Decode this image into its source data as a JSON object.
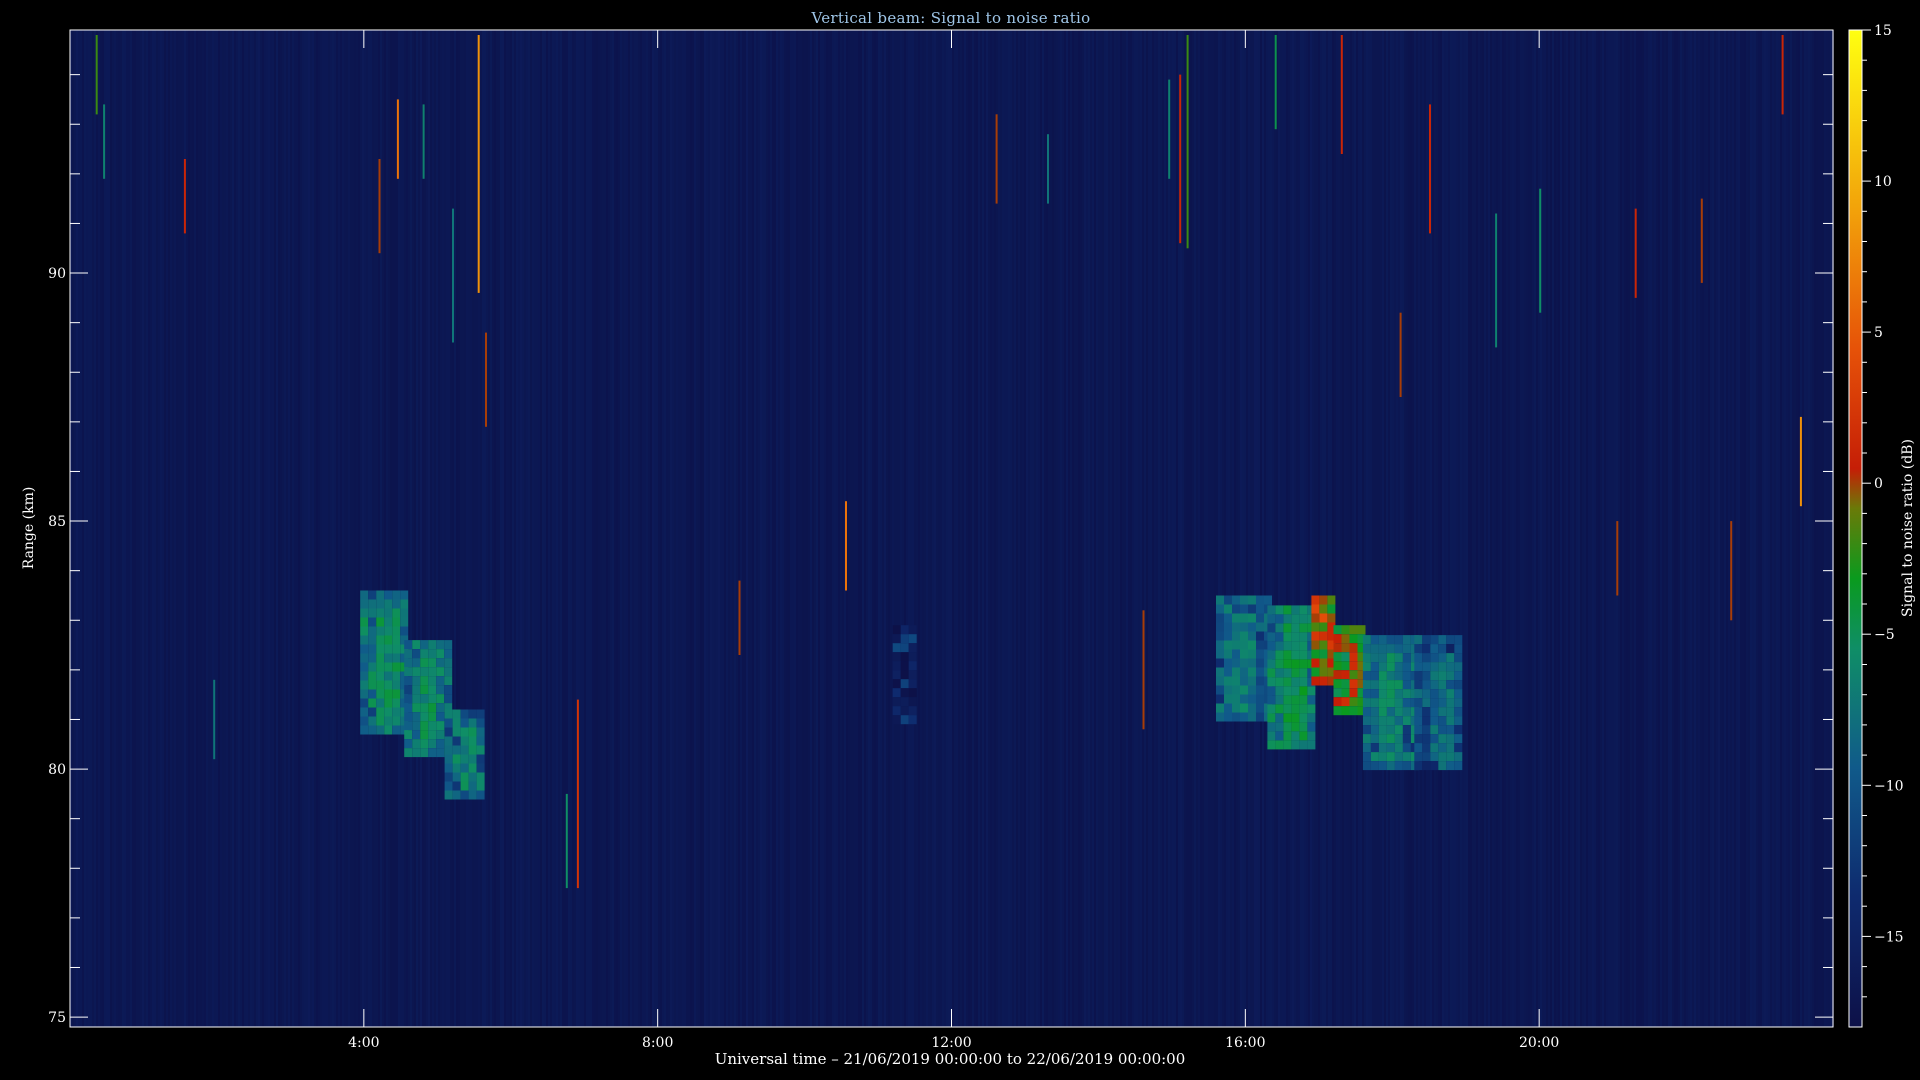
{
  "chart_data": {
    "type": "heatmap",
    "title": "Vertical beam: Signal to noise ratio",
    "xlabel": "Universal time – 21/06/2019 00:00:00 to 22/06/2019 00:00:00",
    "ylabel": "Range (km)",
    "colorbar_label": "Signal to noise ratio (dB)",
    "x_range_hours": [
      0,
      24
    ],
    "y_range_km": [
      74.8,
      94.9
    ],
    "color_range_db": [
      -18,
      15
    ],
    "x_ticks": [
      {
        "hours": 4,
        "label": "4:00"
      },
      {
        "hours": 8,
        "label": "8:00"
      },
      {
        "hours": 12,
        "label": "12:00"
      },
      {
        "hours": 16,
        "label": "16:00"
      },
      {
        "hours": 20,
        "label": "20:00"
      }
    ],
    "y_ticks": [
      {
        "km": 75,
        "label": "75"
      },
      {
        "km": 80,
        "label": "80"
      },
      {
        "km": 85,
        "label": "85"
      },
      {
        "km": 90,
        "label": "90"
      }
    ],
    "colorbar_ticks": [
      {
        "db": 15,
        "label": "15"
      },
      {
        "db": 10,
        "label": "10"
      },
      {
        "db": 5,
        "label": "5"
      },
      {
        "db": 0,
        "label": "0"
      },
      {
        "db": -5,
        "label": "−5"
      },
      {
        "db": -10,
        "label": "−10"
      },
      {
        "db": -15,
        "label": "−15"
      }
    ],
    "background_db": -17,
    "echo_regions": [
      {
        "t0": 3.95,
        "t1": 4.55,
        "r0": 80.8,
        "r1": 83.6,
        "snr_db": -6
      },
      {
        "t0": 4.55,
        "t1": 5.1,
        "r0": 80.3,
        "r1": 82.6,
        "snr_db": -6
      },
      {
        "t0": 5.1,
        "t1": 5.6,
        "r0": 79.5,
        "r1": 81.2,
        "snr_db": -7
      },
      {
        "t0": 11.2,
        "t1": 11.5,
        "r0": 81.0,
        "r1": 82.9,
        "snr_db": -13
      },
      {
        "t0": 15.6,
        "t1": 16.3,
        "r0": 81.0,
        "r1": 83.5,
        "snr_db": -8
      },
      {
        "t0": 16.3,
        "t1": 16.9,
        "r0": 80.5,
        "r1": 83.3,
        "snr_db": -5
      },
      {
        "t0": 16.9,
        "t1": 17.2,
        "r0": 81.7,
        "r1": 83.5,
        "snr_db": 2
      },
      {
        "t0": 17.2,
        "t1": 17.6,
        "r0": 81.1,
        "r1": 82.9,
        "snr_db": 0
      },
      {
        "t0": 17.6,
        "t1": 18.3,
        "r0": 80.0,
        "r1": 82.7,
        "snr_db": -7
      },
      {
        "t0": 18.3,
        "t1": 18.9,
        "r0": 80.0,
        "r1": 82.7,
        "snr_db": -9
      }
    ],
    "spikes": [
      {
        "t": 0.35,
        "r0": 93.2,
        "r1": 94.8,
        "snr_db": -2
      },
      {
        "t": 0.45,
        "r0": 91.9,
        "r1": 93.4,
        "snr_db": -7
      },
      {
        "t": 1.55,
        "r0": 90.8,
        "r1": 92.3,
        "snr_db": 1
      },
      {
        "t": 1.95,
        "r0": 80.2,
        "r1": 81.8,
        "snr_db": -8
      },
      {
        "t": 4.2,
        "r0": 90.4,
        "r1": 92.3,
        "snr_db": 0
      },
      {
        "t": 4.45,
        "r0": 91.9,
        "r1": 93.5,
        "snr_db": 6
      },
      {
        "t": 4.8,
        "r0": 91.9,
        "r1": 93.4,
        "snr_db": -7
      },
      {
        "t": 5.2,
        "r0": 88.6,
        "r1": 91.3,
        "snr_db": -8
      },
      {
        "t": 5.55,
        "r0": 89.6,
        "r1": 94.8,
        "snr_db": 8
      },
      {
        "t": 5.65,
        "r0": 86.9,
        "r1": 88.8,
        "snr_db": 0
      },
      {
        "t": 6.9,
        "r0": 77.6,
        "r1": 81.4,
        "snr_db": 2
      },
      {
        "t": 6.75,
        "r0": 77.6,
        "r1": 79.5,
        "snr_db": -6
      },
      {
        "t": 9.1,
        "r0": 82.3,
        "r1": 83.8,
        "snr_db": 0
      },
      {
        "t": 10.55,
        "r0": 83.6,
        "r1": 85.4,
        "snr_db": 6
      },
      {
        "t": 12.6,
        "r0": 91.4,
        "r1": 93.2,
        "snr_db": 0
      },
      {
        "t": 13.3,
        "r0": 91.4,
        "r1": 92.8,
        "snr_db": -8
      },
      {
        "t": 14.6,
        "r0": 80.8,
        "r1": 83.2,
        "snr_db": 0
      },
      {
        "t": 14.95,
        "r0": 91.9,
        "r1": 93.9,
        "snr_db": -7
      },
      {
        "t": 15.1,
        "r0": 90.6,
        "r1": 94.0,
        "snr_db": 1
      },
      {
        "t": 15.2,
        "r0": 90.5,
        "r1": 94.8,
        "snr_db": -2
      },
      {
        "t": 16.4,
        "r0": 92.9,
        "r1": 94.8,
        "snr_db": -5
      },
      {
        "t": 17.3,
        "r0": 92.4,
        "r1": 94.8,
        "snr_db": 1
      },
      {
        "t": 18.1,
        "r0": 87.5,
        "r1": 89.2,
        "snr_db": 0
      },
      {
        "t": 18.5,
        "r0": 90.8,
        "r1": 93.4,
        "snr_db": 1
      },
      {
        "t": 20.0,
        "r0": 89.2,
        "r1": 91.7,
        "snr_db": -6
      },
      {
        "t": 21.3,
        "r0": 89.5,
        "r1": 91.3,
        "snr_db": 1
      },
      {
        "t": 22.2,
        "r0": 89.8,
        "r1": 91.5,
        "snr_db": 0
      },
      {
        "t": 23.3,
        "r0": 93.2,
        "r1": 94.8,
        "snr_db": 1
      },
      {
        "t": 23.55,
        "r0": 85.3,
        "r1": 87.1,
        "snr_db": 8
      },
      {
        "t": 19.4,
        "r0": 88.5,
        "r1": 91.2,
        "snr_db": -7
      },
      {
        "t": 21.05,
        "r0": 83.5,
        "r1": 85.0,
        "snr_db": 0
      },
      {
        "t": 22.6,
        "r0": 83.0,
        "r1": 85.0,
        "snr_db": 0
      }
    ]
  }
}
